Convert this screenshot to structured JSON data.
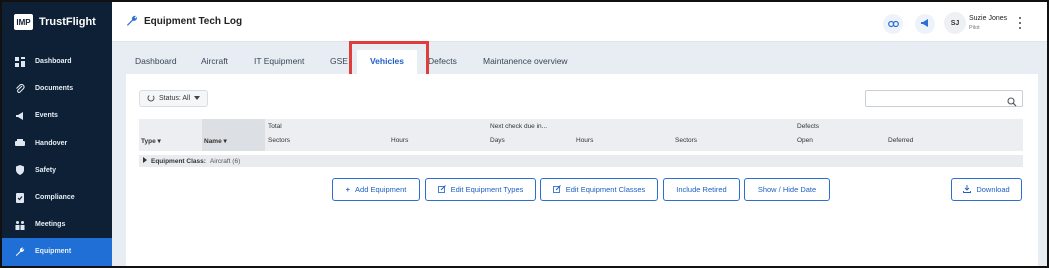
{
  "brand": {
    "logo": "IMP",
    "name": "TrustFlight"
  },
  "sidebar": {
    "items": [
      {
        "label": "Dashboard",
        "icon": "dashboard-icon"
      },
      {
        "label": "Documents",
        "icon": "paperclip-icon"
      },
      {
        "label": "Events",
        "icon": "megaphone-icon"
      },
      {
        "label": "Handover",
        "icon": "handover-icon"
      },
      {
        "label": "Safety",
        "icon": "shield-icon"
      },
      {
        "label": "Compliance",
        "icon": "compliance-icon"
      },
      {
        "label": "Meetings",
        "icon": "meetings-icon"
      },
      {
        "label": "Equipment",
        "icon": "wrench-icon",
        "active": true
      }
    ]
  },
  "header": {
    "title": "Equipment Tech Log",
    "title_icon": "wrench-icon",
    "user": {
      "initials": "SJ",
      "name": "Suzie Jones",
      "role": "Pilot"
    }
  },
  "tabs": [
    {
      "label": "Dashboard"
    },
    {
      "label": "Aircraft"
    },
    {
      "label": "IT Equipment"
    },
    {
      "label": "GSE"
    },
    {
      "label": "Vehicles",
      "active": true
    },
    {
      "label": "Defects"
    },
    {
      "label": "Maintanence overview"
    }
  ],
  "filters": {
    "status_label": "Status: All"
  },
  "table": {
    "group_headers": {
      "total": "Total",
      "next_check": "Next check due in...",
      "defects": "Defects"
    },
    "columns": [
      "Type",
      "Name",
      "Sectors",
      "Hours",
      "Days",
      "Hours",
      "Sectors",
      "Open",
      "Deferred"
    ],
    "group_row": {
      "label": "Equipment Class:",
      "value": "Aircraft (6)"
    }
  },
  "actions": [
    {
      "label": "Add Equipment",
      "icon": "plus-icon"
    },
    {
      "label": "Edit Equipment Types",
      "icon": "edit-icon"
    },
    {
      "label": "Edit Equipment Classes",
      "icon": "edit-icon"
    },
    {
      "label": "Include Retired",
      "icon": ""
    },
    {
      "label": "Show / Hide Date",
      "icon": ""
    },
    {
      "label": "Download",
      "icon": "download-icon"
    }
  ],
  "colors": {
    "sidebar": "#0d2035",
    "accent": "#1f6fd6",
    "highlight": "#e03c3c"
  }
}
